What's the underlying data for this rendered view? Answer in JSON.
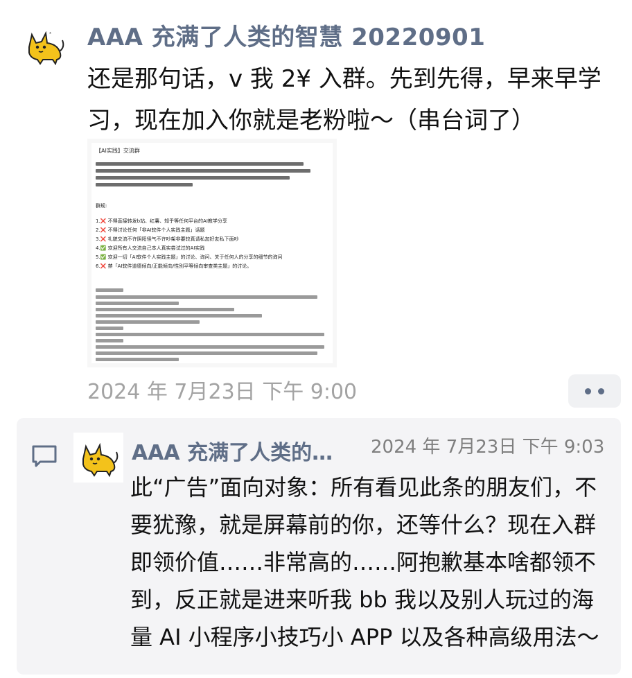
{
  "post": {
    "avatar_icon": "cat-avatar-icon",
    "author": "AAA 充满了人类的智慧 20220901",
    "text": "还是那句话，v 我 2¥ 入群。先到先得，早来早学习，现在加入你就是老粉啦～（串台词了）",
    "time": "2024 年 7月23日 下午 9:00",
    "more_icon": "more-dots-icon",
    "image": {
      "title": "【AI实践】交流群",
      "rules_heading": "群规:",
      "rules": [
        {
          "mark": "x",
          "text": "1.❌ 不得直接转发b站、红薯、知乎等任何平台的AI教学分享"
        },
        {
          "mark": "x",
          "text": "2.❌ 不得讨论任何「非AI软件个人实践主题」话题"
        },
        {
          "mark": "x",
          "text": "3.❌ 礼貌交流不许阴阳怪气不许吵架非要较真请私加好友私下面吵"
        },
        {
          "mark": "ok",
          "text": "4.✅ 欢迎所有人交流自己本人真实尝试过的AI实践"
        },
        {
          "mark": "ok",
          "text": "5.✅ 欢迎一切「AI软件个人实践主题」的讨论、询问、关于任何人的分享的细节的询问"
        },
        {
          "mark": "x",
          "text": "6.❌ 禁「AI软件道德倾向/正能倾向/性别平等倾向审查类主题」的讨论。"
        }
      ]
    }
  },
  "comment": {
    "icon": "comment-icon",
    "avatar_icon": "cat-avatar-icon",
    "author": "AAA 充满了人类的…",
    "time": "2024 年 7月23日 下午 9:03",
    "text": "此“广告”面向对象：所有看见此条的朋友们，不要犹豫，就是屏幕前的你，还等什么？现在入群即领价值……非常高的……阿抱歉基本啥都领不到，反正就是进来听我 bb 我以及别人玩过的海量 AI 小程序小技巧小 APP 以及各种高级用法～"
  }
}
